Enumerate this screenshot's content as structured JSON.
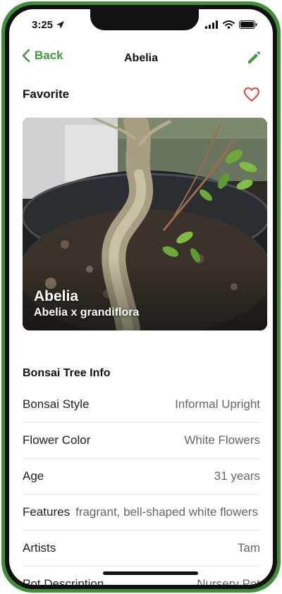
{
  "status": {
    "time": "3:25"
  },
  "nav": {
    "back_label": "Back",
    "title": "Abelia"
  },
  "favorite": {
    "label": "Favorite"
  },
  "photo": {
    "name": "Abelia",
    "scientific_name": "Abelia x grandiflora"
  },
  "info": {
    "title": "Bonsai Tree Info",
    "rows": [
      {
        "label": "Bonsai Style",
        "value": "Informal Upright"
      },
      {
        "label": "Flower Color",
        "value": "White Flowers"
      },
      {
        "label": "Age",
        "value": "31 years"
      },
      {
        "label": "Features",
        "value": "fragrant, bell-shaped white flowers"
      },
      {
        "label": "Artists",
        "value": "Tam"
      },
      {
        "label": "Pot Description",
        "value": "Nursery Pot"
      }
    ]
  },
  "colors": {
    "accent": "#3e9a3a",
    "favorite": "#e0453a",
    "frame": "#3f8f3a"
  },
  "icons": [
    "location-arrow-icon",
    "signal-icon",
    "wifi-icon",
    "battery-icon",
    "chevron-left-icon",
    "pencil-icon",
    "heart-outline-icon"
  ]
}
